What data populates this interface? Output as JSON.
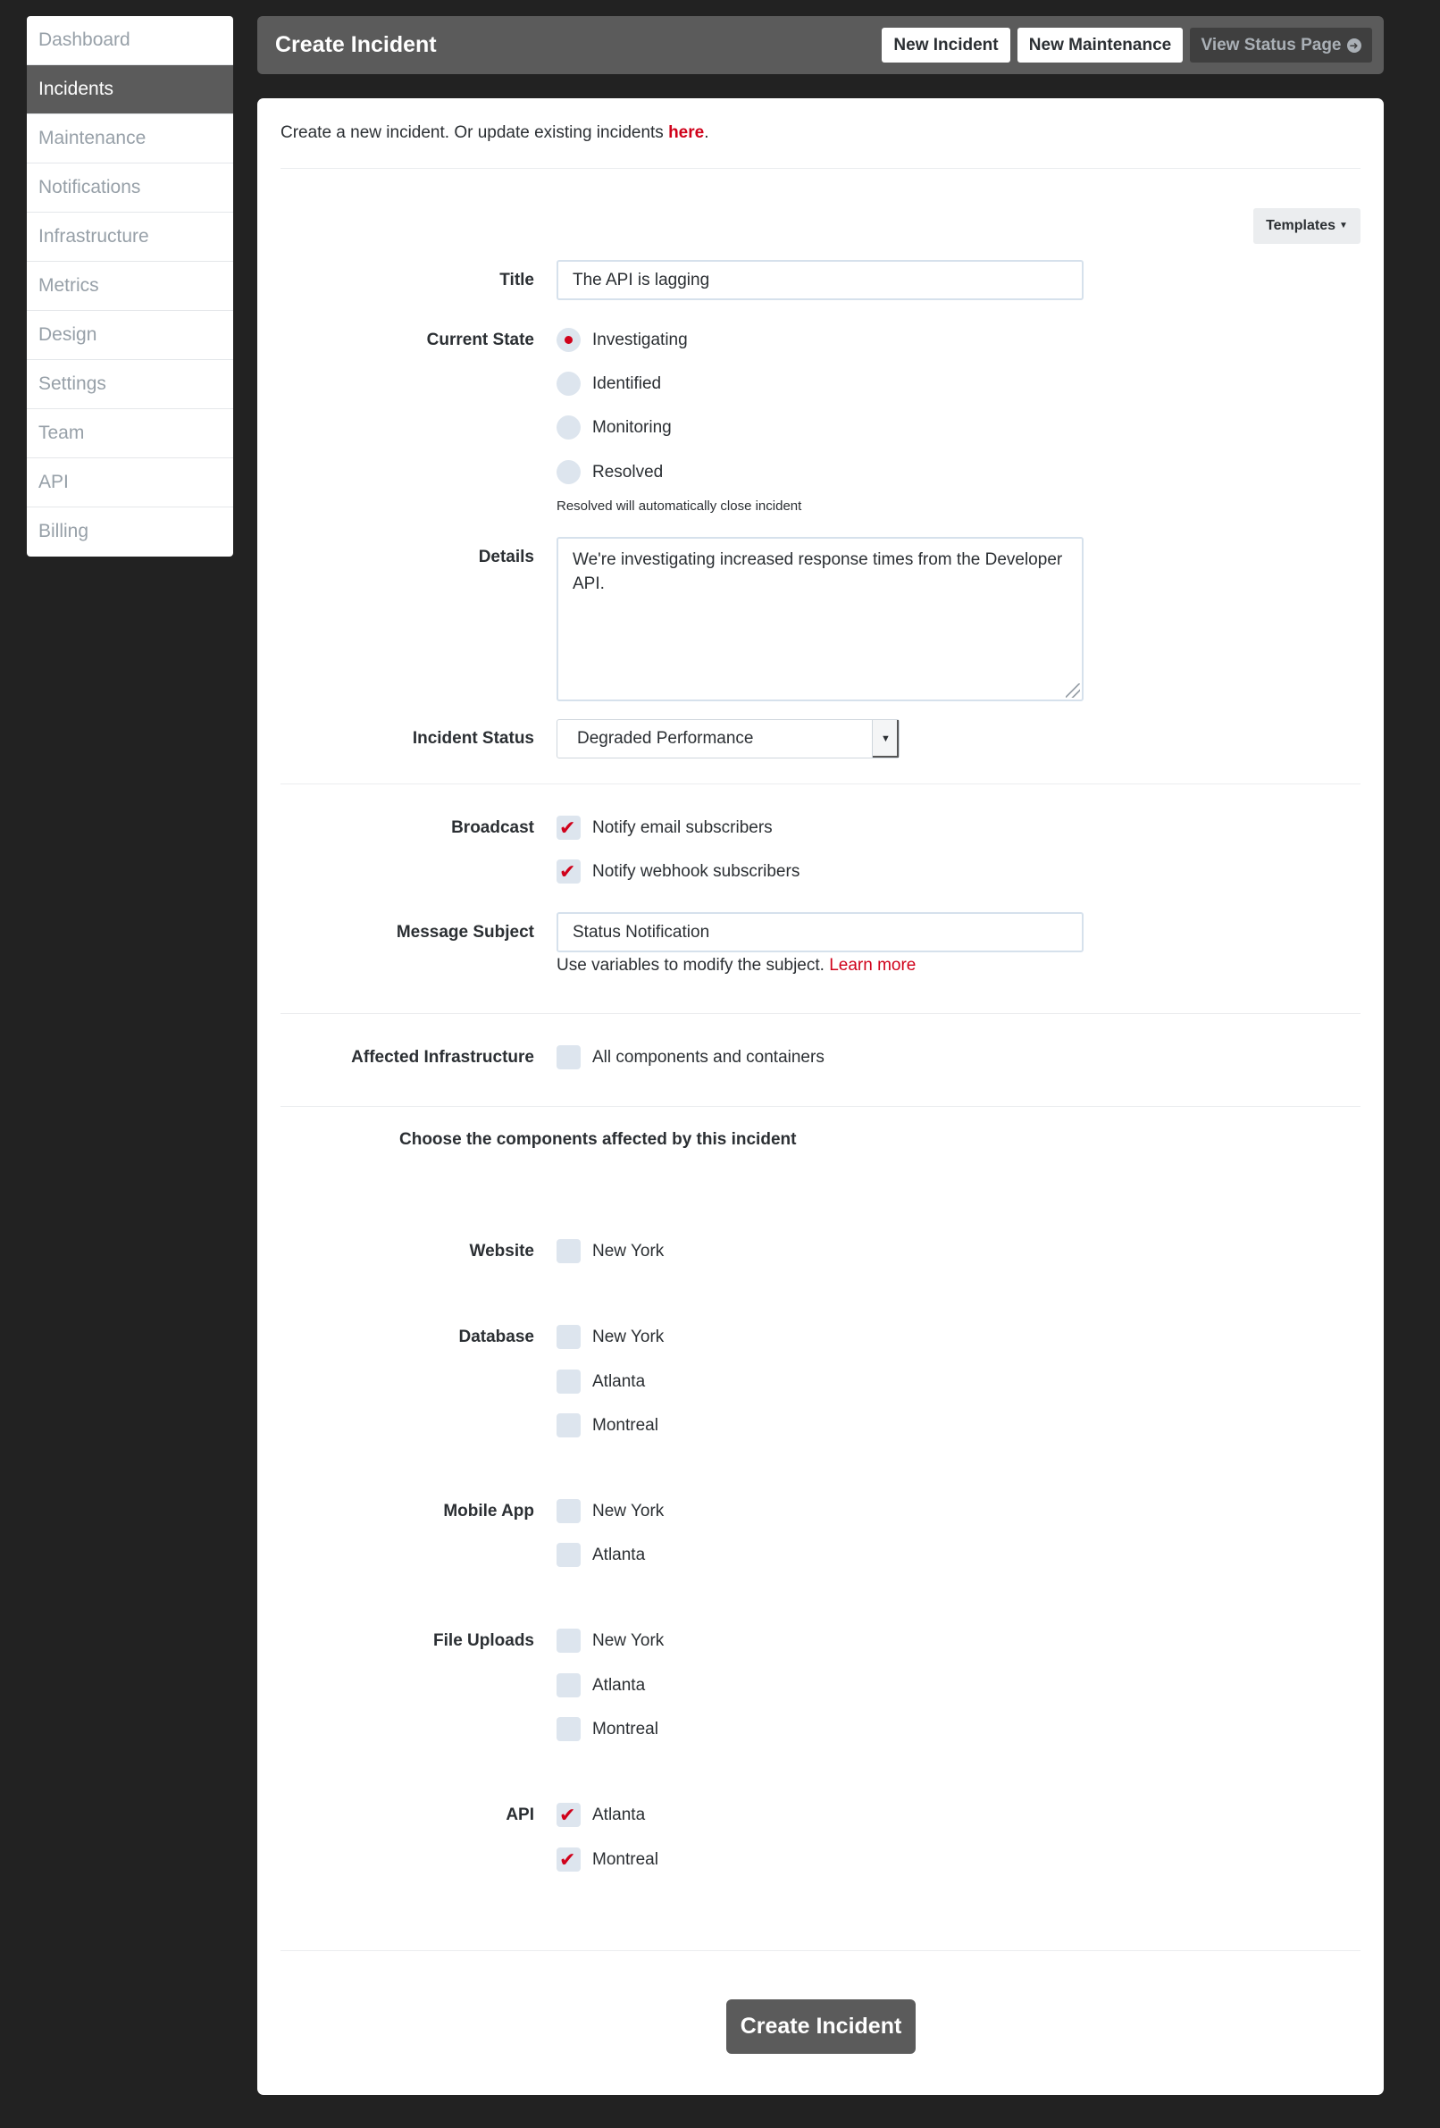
{
  "sidebar": {
    "items": [
      {
        "label": "Dashboard"
      },
      {
        "label": "Incidents"
      },
      {
        "label": "Maintenance"
      },
      {
        "label": "Notifications"
      },
      {
        "label": "Infrastructure"
      },
      {
        "label": "Metrics"
      },
      {
        "label": "Design"
      },
      {
        "label": "Settings"
      },
      {
        "label": "Team"
      },
      {
        "label": "API"
      },
      {
        "label": "Billing"
      }
    ],
    "active_item": "Incidents"
  },
  "header": {
    "title": "Create Incident",
    "new_incident_label": "New Incident",
    "new_maintenance_label": "New Maintenance",
    "view_status_page_label": "View Status Page",
    "view_status_page_icon": "arrow-circle-right-icon"
  },
  "intro": {
    "text": "Create a new incident. Or update existing incidents ",
    "link": "here",
    "suffix": "."
  },
  "templates_button": {
    "label": "Templates",
    "icon": "caret-down-icon"
  },
  "form": {
    "title": {
      "label": "Title",
      "value": "The API is lagging"
    },
    "current_state": {
      "label": "Current State",
      "options": [
        "Investigating",
        "Identified",
        "Monitoring",
        "Resolved"
      ],
      "selected": "Investigating",
      "help": "Resolved will automatically close incident"
    },
    "details": {
      "label": "Details",
      "value": "We're investigating increased response times from the Developer API."
    },
    "incident_status": {
      "label": "Incident Status",
      "value": "Degraded Performance"
    },
    "broadcast": {
      "label": "Broadcast",
      "options": [
        {
          "label": "Notify email subscribers",
          "checked": true
        },
        {
          "label": "Notify webhook subscribers",
          "checked": true
        }
      ]
    },
    "message_subject": {
      "label": "Message Subject",
      "value": "Status Notification",
      "help": "Use variables to modify the subject. ",
      "help_link": "Learn more"
    },
    "affected_infrastructure": {
      "label": "Affected Infrastructure",
      "option": "All components and containers",
      "checked": false
    },
    "components_heading": "Choose the components affected by this incident",
    "components": [
      {
        "name": "Website",
        "locations": [
          {
            "label": "New York",
            "checked": false
          }
        ]
      },
      {
        "name": "Database",
        "locations": [
          {
            "label": "New York",
            "checked": false
          },
          {
            "label": "Atlanta",
            "checked": false
          },
          {
            "label": "Montreal",
            "checked": false
          }
        ]
      },
      {
        "name": "Mobile App",
        "locations": [
          {
            "label": "New York",
            "checked": false
          },
          {
            "label": "Atlanta",
            "checked": false
          }
        ]
      },
      {
        "name": "File Uploads",
        "locations": [
          {
            "label": "New York",
            "checked": false
          },
          {
            "label": "Atlanta",
            "checked": false
          },
          {
            "label": "Montreal",
            "checked": false
          }
        ]
      },
      {
        "name": "API",
        "locations": [
          {
            "label": "Atlanta",
            "checked": true
          },
          {
            "label": "Montreal",
            "checked": true
          }
        ]
      }
    ],
    "submit_label": "Create Incident"
  },
  "colors": {
    "background": "#222222",
    "accent": "#d0021b",
    "header_bg": "#5b5b5b",
    "control_bg": "#dde5ee"
  }
}
